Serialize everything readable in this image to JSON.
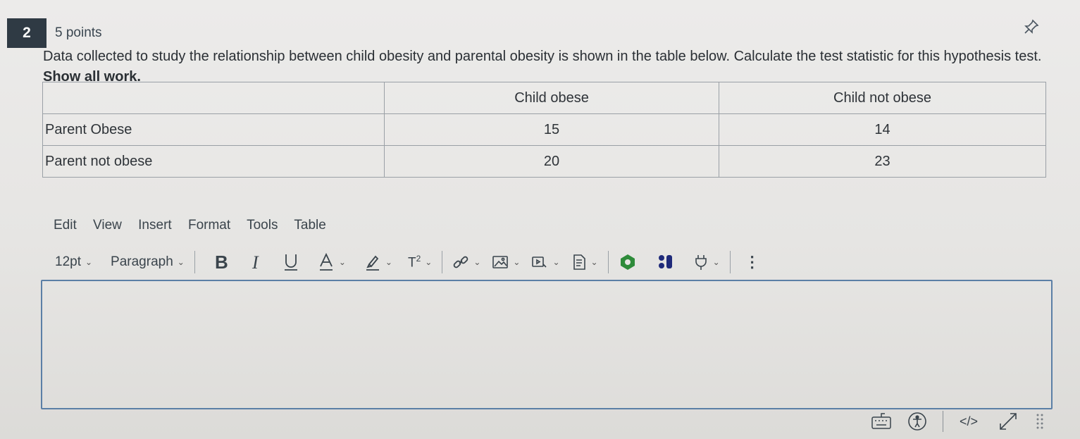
{
  "question": {
    "number": "2",
    "points": "5 points",
    "text_main": "Data collected to study the relationship between child obesity and parental obesity is shown in the table below. Calculate the test statistic for this hypothesis test.",
    "text_emphasis": "Show all work."
  },
  "table": {
    "headers": [
      "",
      "Child obese",
      "Child not obese"
    ],
    "rows": [
      {
        "label": "Parent Obese",
        "values": [
          "15",
          "14"
        ]
      },
      {
        "label": "Parent not obese",
        "values": [
          "20",
          "23"
        ]
      }
    ]
  },
  "editor": {
    "menu": [
      "Edit",
      "View",
      "Insert",
      "Format",
      "Tools",
      "Table"
    ],
    "font_size": "12pt",
    "block_format": "Paragraph",
    "superscript_label": "T",
    "superscript_exp": "2",
    "code_view_label": "</>",
    "content": ""
  },
  "colors": {
    "badge": "#2f3a44",
    "editor_border": "#5b7fa6",
    "plugin_green": "#2e8b3a",
    "plugin_navy": "#1f2a7a"
  }
}
